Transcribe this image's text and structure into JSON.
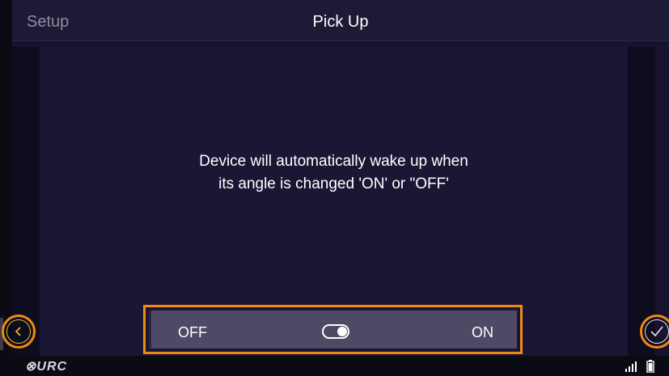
{
  "header": {
    "back_label": "Setup",
    "title": "Pick Up"
  },
  "message": {
    "line1": "Device will automatically wake up when",
    "line2": "its angle is changed 'ON' or \"OFF'"
  },
  "toggle": {
    "off_label": "OFF",
    "on_label": "ON",
    "state": "on"
  },
  "footer": {
    "logo_text": "⊗URC",
    "icons": [
      "signal-icon",
      "battery-icon"
    ]
  },
  "nav": {
    "back_icon": "chevron-left-icon",
    "done_icon": "checkmark-icon"
  },
  "colors": {
    "highlight": "#f08a10",
    "back_ring": "#f0c020",
    "background": "#17132e"
  }
}
